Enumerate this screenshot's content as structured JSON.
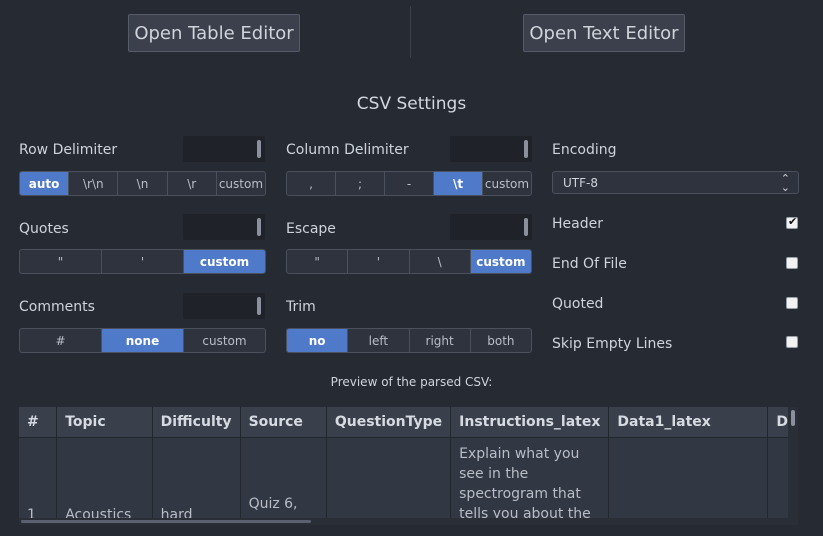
{
  "toolbar": {
    "open_table_editor": "Open Table Editor",
    "open_text_editor": "Open Text Editor"
  },
  "settings": {
    "title": "CSV Settings",
    "row_delimiter": {
      "label": "Row Delimiter",
      "options": [
        "auto",
        "\\r\\n",
        "\\n",
        "\\r",
        "custom"
      ],
      "selected": "auto"
    },
    "column_delimiter": {
      "label": "Column Delimiter",
      "options": [
        ",",
        ";",
        "-",
        "\\t",
        "custom"
      ],
      "selected": "\\t"
    },
    "quotes": {
      "label": "Quotes",
      "options": [
        "\"",
        "'",
        "custom"
      ],
      "selected": "custom"
    },
    "escape": {
      "label": "Escape",
      "options": [
        "\"",
        "'",
        "\\",
        "custom"
      ],
      "selected": "custom"
    },
    "comments": {
      "label": "Comments",
      "options": [
        "#",
        "none",
        "custom"
      ],
      "selected": "none"
    },
    "trim": {
      "label": "Trim",
      "options": [
        "no",
        "left",
        "right",
        "both"
      ],
      "selected": "no"
    },
    "encoding": {
      "label": "Encoding",
      "value": "UTF-8",
      "arrows_icon": "chevron-up-down-icon"
    },
    "header": {
      "label": "Header",
      "checked": true
    },
    "end_of_file": {
      "label": "End Of File",
      "checked": false
    },
    "quoted": {
      "label": "Quoted",
      "checked": false
    },
    "skip_empty_lines": {
      "label": "Skip Empty Lines",
      "checked": false
    }
  },
  "preview": {
    "label": "Preview of the parsed CSV:",
    "columns": [
      "#",
      "Topic",
      "Difficulty",
      "Source",
      "QuestionType",
      "Instructions_latex",
      "Data1_latex",
      "D"
    ],
    "rows": [
      [
        "1",
        "Acoustics",
        "hard",
        "Quiz 6,",
        "",
        "Explain what you see in the spectrogram that tells you about the",
        "",
        ""
      ]
    ]
  },
  "colors": {
    "background": "#262a33",
    "accent": "#4f79c9"
  }
}
